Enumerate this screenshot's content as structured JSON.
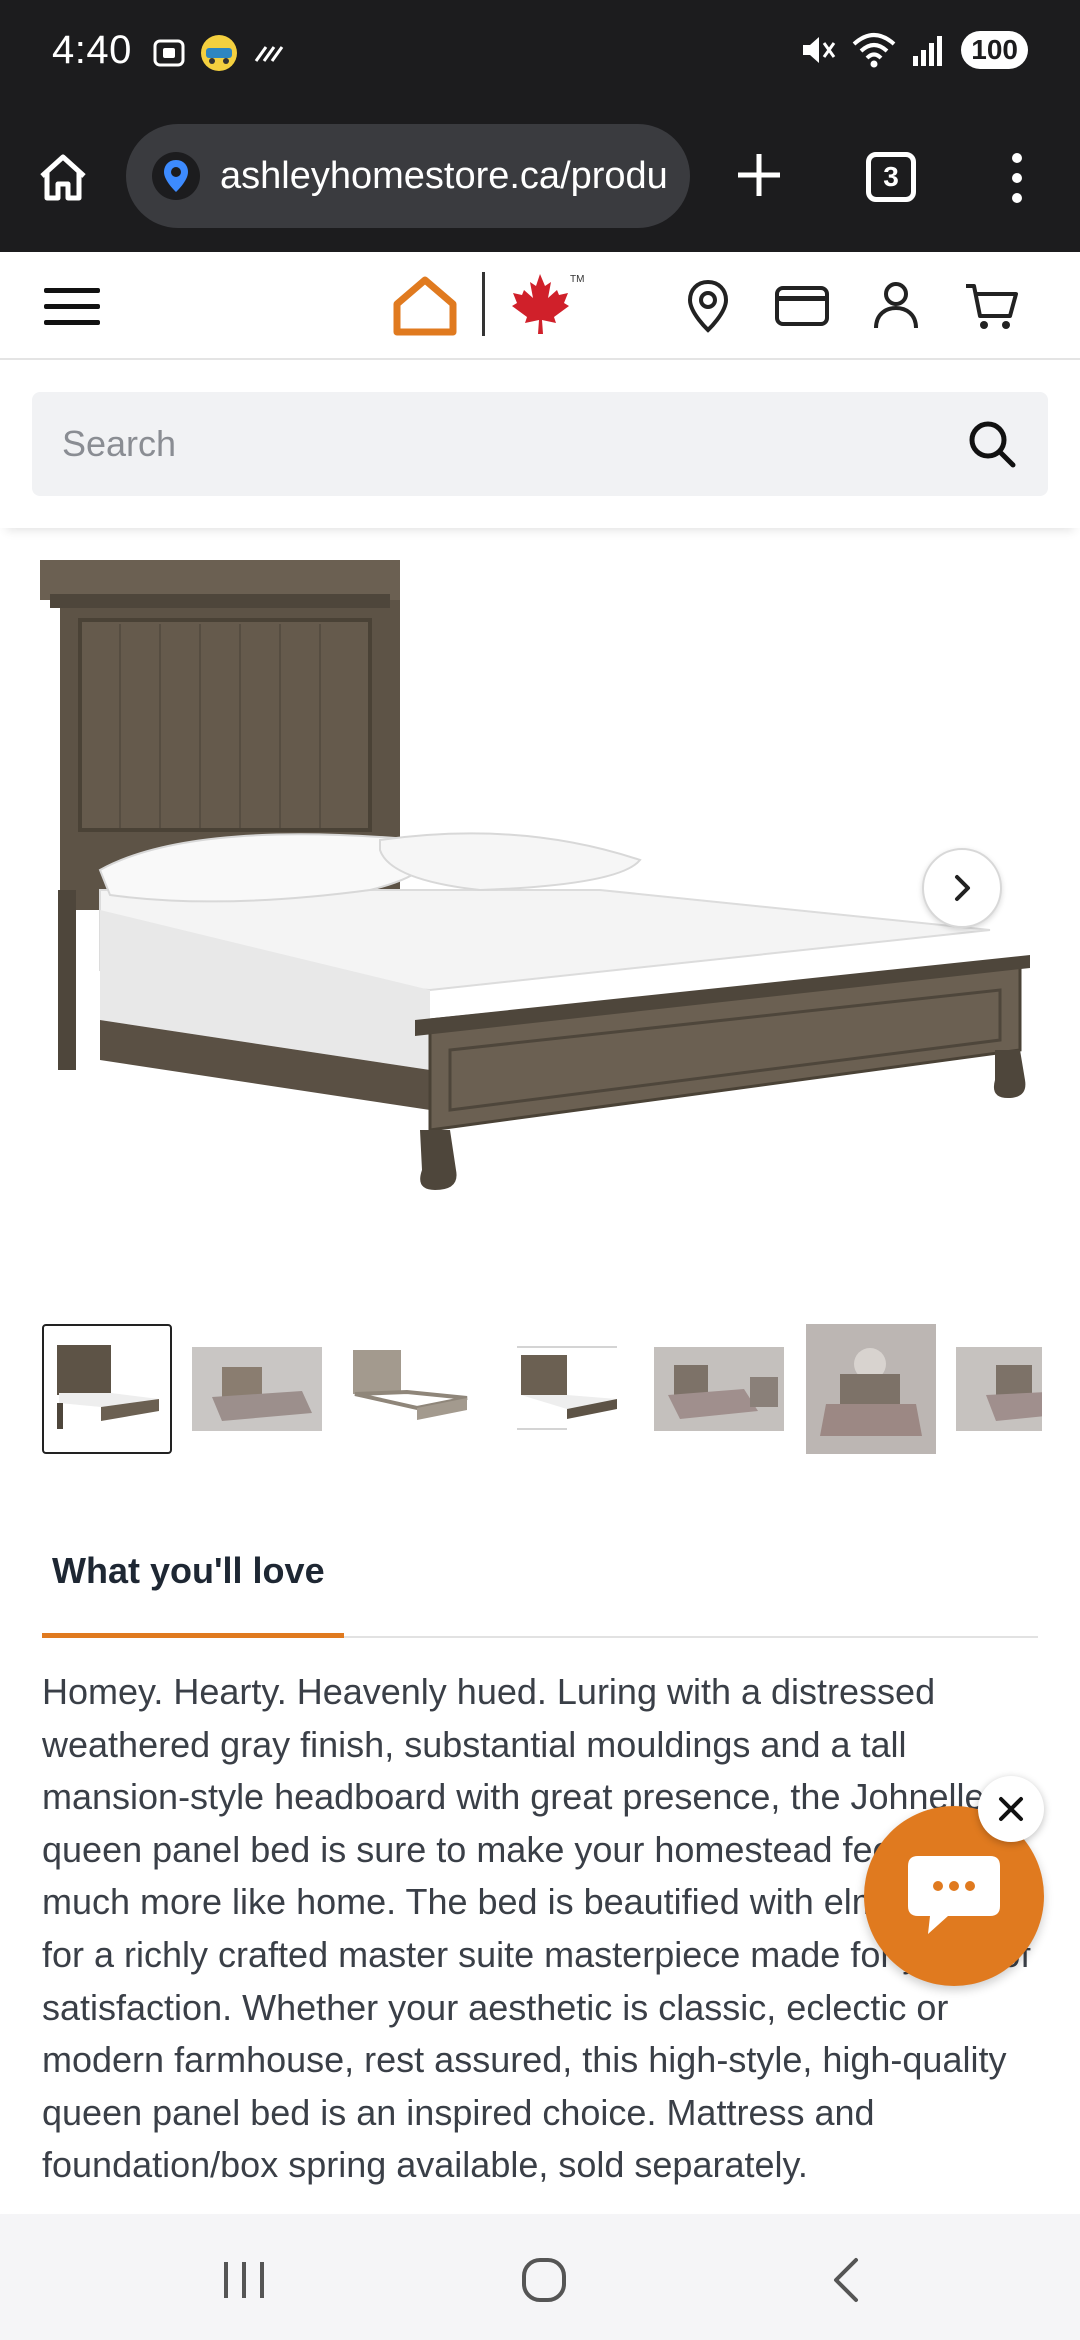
{
  "status_bar": {
    "time": "4:40",
    "battery": "100",
    "icons": [
      "screenshot-icon",
      "app-notification-icon",
      "sync-icon",
      "mute-icon",
      "wifi-icon",
      "signal-icon",
      "battery-icon"
    ]
  },
  "browser": {
    "url": "ashleyhomestore.ca/produ",
    "tab_count": "3",
    "icons": [
      "home-icon",
      "location-pin-icon",
      "plus-icon",
      "tabs-icon",
      "more-vert-icon"
    ]
  },
  "site_header": {
    "icons": [
      "hamburger-menu-icon",
      "ashley-home-logo",
      "maple-leaf-logo",
      "store-location-icon",
      "credit-card-icon",
      "account-icon",
      "cart-icon"
    ],
    "brand_color": "#e07a1f",
    "maple_color": "#d0202a"
  },
  "search": {
    "placeholder": "Search",
    "value": ""
  },
  "product": {
    "thumbnails_count": 7,
    "selected_thumbnail": 1
  },
  "tabs": {
    "active_label": "What you'll love"
  },
  "description": "Homey. Hearty. Heavenly hued. Luring with a distressed weathered gray finish, substantial mouldings and a tall mansion-style headboard with great presence, the Johnelle queen panel bed is sure to make your homestead feel that much more like home. The bed is beautified with elm veneers for a richly crafted master suite masterpiece made for years of satisfaction. Whether your aesthetic is classic, eclectic or modern farmhouse, rest assured, this high-style, high-quality queen panel bed is an inspired choice. Mattress and foundation/box spring available, sold separately.",
  "nav_bar": {
    "icons": [
      "recents-icon",
      "home-circle-icon",
      "back-icon"
    ]
  }
}
